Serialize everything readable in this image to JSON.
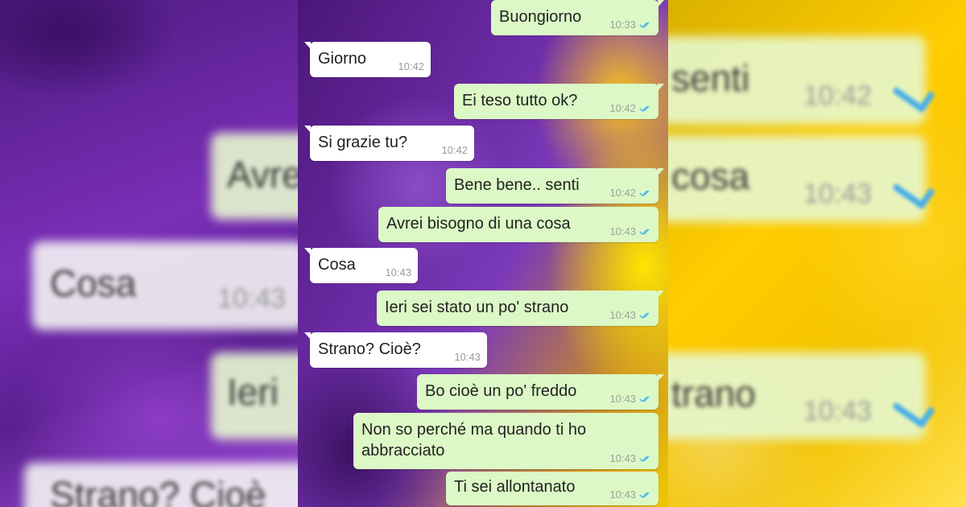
{
  "messages": [
    {
      "side": "sent",
      "text": "Buongiorno",
      "time": "10:33",
      "read": true
    },
    {
      "side": "recv",
      "text": "Giorno",
      "time": "10:42"
    },
    {
      "side": "sent",
      "text": "Ei teso tutto ok?",
      "time": "10:42",
      "read": true
    },
    {
      "side": "recv",
      "text": "Si grazie tu?",
      "time": "10:42"
    },
    {
      "side": "sent",
      "text": "Bene bene.. senti",
      "time": "10:42",
      "read": true
    },
    {
      "side": "sent",
      "text": "Avrei bisogno di una cosa",
      "time": "10:43",
      "read": true
    },
    {
      "side": "recv",
      "text": "Cosa",
      "time": "10:43"
    },
    {
      "side": "sent",
      "text": "Ieri sei stato un po' strano",
      "time": "10:43",
      "read": true
    },
    {
      "side": "recv",
      "text": "Strano? Cioè?",
      "time": "10:43"
    },
    {
      "side": "sent",
      "text": "Bo cioè un po' freddo",
      "time": "10:43",
      "read": true
    },
    {
      "side": "sent",
      "text": "Non so perché ma quando ti ho",
      "text2": "abbracciato",
      "time": "10:43",
      "read": true
    },
    {
      "side": "sent",
      "text": "Ti sei allontanato",
      "time": "10:43",
      "read": true
    }
  ],
  "blurred_left": {
    "fragments": [
      "Avre",
      "Cosa",
      "10:43",
      "Ieri",
      "Strano? Cioè"
    ]
  },
  "blurred_right": {
    "fragments": [
      "senti",
      "10:42",
      "cosa",
      "10:43",
      "trano",
      "10:43"
    ]
  },
  "colors": {
    "sent_bubble": "#dcf8c6",
    "recv_bubble": "#ffffff",
    "read_tick": "#4fb6ec"
  },
  "icons": {
    "read_receipt": "double-check-icon"
  }
}
